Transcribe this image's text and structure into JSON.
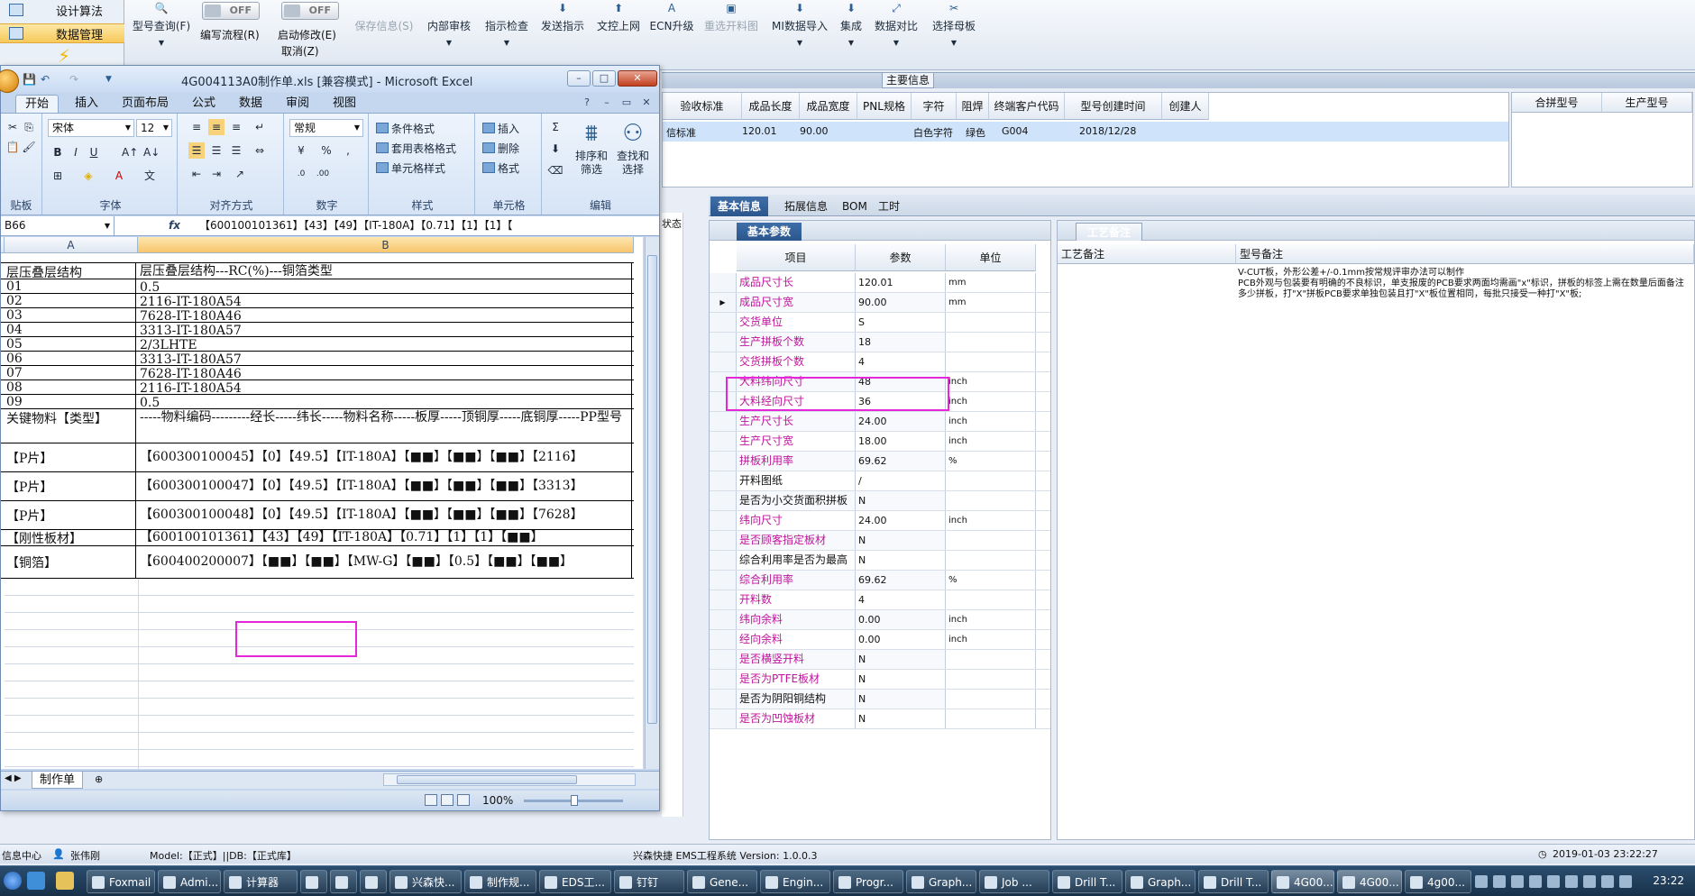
{
  "left_nav": {
    "items": [
      {
        "label": "设计算法",
        "active": false
      },
      {
        "label": "数据管理",
        "active": true
      }
    ]
  },
  "toolbar": {
    "buttons": [
      {
        "label": "型号查询(F)",
        "icon": "search-icon",
        "enabled": true
      },
      {
        "label": "保存信息(S)",
        "icon": "save-icon",
        "enabled": false
      },
      {
        "label": "内部审核",
        "icon": "review-icon",
        "enabled": true
      },
      {
        "label": "指示检查",
        "icon": "check-icon",
        "enabled": true
      },
      {
        "label": "发送指示",
        "icon": "send-icon",
        "enabled": true
      },
      {
        "label": "文控上网",
        "icon": "upload-icon",
        "enabled": true
      },
      {
        "label": "ECN升级",
        "icon": "upgrade-icon",
        "enabled": true
      },
      {
        "label": "重选开料图",
        "icon": "image-icon",
        "enabled": false
      },
      {
        "label": "MI数据导入",
        "icon": "import-icon",
        "enabled": true
      },
      {
        "label": "集成",
        "icon": "integrate-icon",
        "enabled": true
      },
      {
        "label": "数据对比",
        "icon": "compare-icon",
        "enabled": true
      },
      {
        "label": "选择母板",
        "icon": "board-icon",
        "enabled": true
      }
    ],
    "toggle_state": "OFF",
    "toggle_write_label": "编写流程(R)",
    "toggle_edit_label": "启动修改(E)",
    "cancel_label": "取消(Z)"
  },
  "main_info": {
    "title": "主要信息",
    "columns": [
      "验收标准",
      "成品长度",
      "成品宽度",
      "PNL规格",
      "字符",
      "阻焊",
      "终端客户代码",
      "型号创建时间",
      "创建人"
    ],
    "row": {
      "standard": "信标准",
      "length": "120.01",
      "width": "90.00",
      "pnl": "",
      "char": "白色字符",
      "mask": "绿色",
      "customer": "G004",
      "created": "2018/12/28",
      "creator": ""
    },
    "merge_columns": [
      "合拼型号",
      "生产型号"
    ]
  },
  "status_strip": {
    "label": "状态"
  },
  "detail_tabs": [
    "基本信息",
    "拓展信息",
    "BOM",
    "工时"
  ],
  "basic_params": {
    "tab": "基本参数",
    "columns": [
      "项目",
      "参数",
      "单位"
    ],
    "rows": [
      {
        "name": "成品尺寸长",
        "value": "120.01",
        "unit": "mm",
        "magenta": true
      },
      {
        "name": "成品尺寸宽",
        "value": "90.00",
        "unit": "mm",
        "magenta": true,
        "selected": true
      },
      {
        "name": "交货单位",
        "value": "S",
        "unit": "",
        "magenta": true
      },
      {
        "name": "生产拼板个数",
        "value": "18",
        "unit": "",
        "magenta": true
      },
      {
        "name": "交货拼板个数",
        "value": "4",
        "unit": "",
        "magenta": true
      },
      {
        "name": "大料纬向尺寸",
        "value": "48",
        "unit": "inch",
        "magenta": true
      },
      {
        "name": "大料经向尺寸",
        "value": "36",
        "unit": "inch",
        "magenta": true
      },
      {
        "name": "生产尺寸长",
        "value": "24.00",
        "unit": "inch",
        "magenta": true
      },
      {
        "name": "生产尺寸宽",
        "value": "18.00",
        "unit": "inch",
        "magenta": true
      },
      {
        "name": "拼板利用率",
        "value": "69.62",
        "unit": "%",
        "magenta": true
      },
      {
        "name": "开料图纸",
        "value": "/",
        "unit": "",
        "magenta": false
      },
      {
        "name": "是否为小交货面积拼板",
        "value": "N",
        "unit": "",
        "magenta": false
      },
      {
        "name": "纬向尺寸",
        "value": "24.00",
        "unit": "inch",
        "magenta": true
      },
      {
        "name": "是否顾客指定板材",
        "value": "N",
        "unit": "",
        "magenta": true
      },
      {
        "name": "综合利用率是否为最高",
        "value": "N",
        "unit": "",
        "magenta": false
      },
      {
        "name": "综合利用率",
        "value": "69.62",
        "unit": "%",
        "magenta": true
      },
      {
        "name": "开料数",
        "value": "4",
        "unit": "",
        "magenta": true
      },
      {
        "name": "纬向余料",
        "value": "0.00",
        "unit": "inch",
        "magenta": true
      },
      {
        "name": "经向余料",
        "value": "0.00",
        "unit": "inch",
        "magenta": true
      },
      {
        "name": "是否横竖开料",
        "value": "N",
        "unit": "",
        "magenta": true
      },
      {
        "name": "是否为PTFE板材",
        "value": "N",
        "unit": "",
        "magenta": true
      },
      {
        "name": "是否为阴阳铜结构",
        "value": "N",
        "unit": "",
        "magenta": false
      },
      {
        "name": "是否为凹蚀板材",
        "value": "N",
        "unit": "",
        "magenta": true
      }
    ]
  },
  "remarks": {
    "tab": "工艺备注",
    "col1": "工艺备注",
    "col2": "型号备注",
    "text": "V-CUT板，外形公差+/-0.1mm按常规评审办法可以制作\nPCB外观与包装要有明确的不良标识，单支报废的PCB要求两面均需画\"x\"标识，拼板的标签上需在数量后面备注多少拼板，打\"X\"拼板PCB要求单独包装且打\"X\"板位置相同，每批只接受一种打\"X\"板;"
  },
  "status_bar": {
    "info_center": "信息中心",
    "user": "张伟刚",
    "model": "Model:【正式】||DB:【正式库】",
    "system": "兴森快捷 EMS工程系统 Version: 1.0.0.3",
    "datetime": "2019-01-03 23:22:27"
  },
  "excel": {
    "title": "4G004113A0制作单.xls [兼容模式] - Microsoft Excel",
    "ribbon_tabs": [
      "开始",
      "插入",
      "页面布局",
      "公式",
      "数据",
      "审阅",
      "视图"
    ],
    "font_name": "宋体",
    "font_size": "12",
    "number_format": "常规",
    "group_labels": {
      "clipboard": "贴板",
      "font": "字体",
      "align": "对齐方式",
      "number": "数字",
      "styles": "样式",
      "cells": "单元格",
      "edit": "编辑"
    },
    "styles_items": [
      "条件格式",
      "套用表格格式",
      "单元格样式"
    ],
    "cells_items": [
      "插入",
      "删除",
      "格式"
    ],
    "edit_sort": "排序和\n筛选",
    "edit_find": "查找和\n选择",
    "name_box": "B66",
    "formula": "【600100101361】【43】【49】【IT-180A】【0.71】【1】【1】【",
    "columns": [
      "A",
      "B"
    ],
    "rows": [
      {
        "a": "层压叠层结构",
        "b": "层压叠层结构---RC(%)---铜箔类型"
      },
      {
        "a": "01",
        "b": "0.5"
      },
      {
        "a": "02",
        "b": "2116-IT-180A54"
      },
      {
        "a": "03",
        "b": "7628-IT-180A46"
      },
      {
        "a": "04",
        "b": "3313-IT-180A57"
      },
      {
        "a": "05",
        "b": "2/3LHTE"
      },
      {
        "a": "06",
        "b": "3313-IT-180A57"
      },
      {
        "a": "07",
        "b": "7628-IT-180A46"
      },
      {
        "a": "08",
        "b": "2116-IT-180A54"
      },
      {
        "a": "09",
        "b": "0.5"
      },
      {
        "a": "关键物料【类型】",
        "b": "-----物料编码---------经长-----纬长-----物料名称-----板厚-----顶铜厚-----底铜厚-----PP型号"
      },
      {
        "a": "【P片】",
        "b": "【600300100045】【0】【49.5】【IT-180A】【■■】【■■】【■■】【2116】"
      },
      {
        "a": "【P片】",
        "b": "【600300100047】【0】【49.5】【IT-180A】【■■】【■■】【■■】【3313】"
      },
      {
        "a": "【P片】",
        "b": "【600300100048】【0】【49.5】【IT-180A】【■■】【■■】【■■】【7628】"
      },
      {
        "a": "【刚性板材】",
        "b": "【600100101361】【43】【49】【IT-180A】【0.71】【1】【1】【■■】"
      },
      {
        "a": "【铜箔】",
        "b": "【600400200007】【■■】【■■】【MW-G】【■■】【0.5】【■■】【■■】"
      }
    ],
    "sheet_tab": "制作单",
    "zoom": "100%"
  },
  "taskbar": {
    "items": [
      "Foxmail",
      "Admi...",
      "计算器",
      "",
      "",
      "",
      "兴森快...",
      "制作规...",
      "EDS工...",
      "钉钉",
      "Gene...",
      "Engin...",
      "Progr...",
      "Graph...",
      "Job ...",
      "Drill T...",
      "Graph...",
      "Drill T...",
      "4G00...",
      "4G00...",
      "4g00..."
    ],
    "clock": "23:22"
  }
}
